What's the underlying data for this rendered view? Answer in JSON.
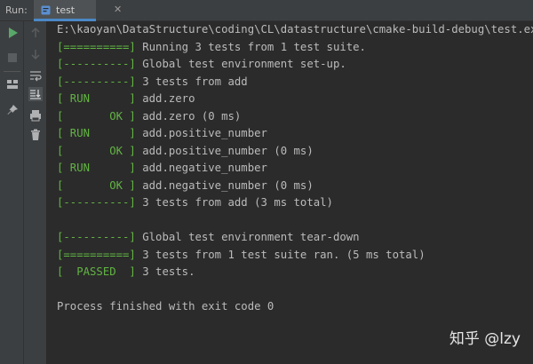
{
  "run_panel": {
    "label": "Run:",
    "tab": {
      "label": "test",
      "icon": "test-config-icon",
      "close_icon": "close-icon"
    }
  },
  "toolbar": {
    "left": [
      "run-icon",
      "stop-icon",
      "layout-icon",
      "pin-icon"
    ],
    "right": [
      "up-arrow-icon",
      "down-arrow-icon",
      "soft-wrap-icon",
      "scroll-to-end-icon",
      "print-icon",
      "delete-icon"
    ]
  },
  "console": {
    "lines": [
      {
        "prefix": "",
        "text": "E:\\kaoyan\\DataStructure\\coding\\CL\\datastructure\\cmake-build-debug\\test.exe"
      },
      {
        "prefix": "[==========]",
        "text": " Running 3 tests from 1 test suite."
      },
      {
        "prefix": "[----------]",
        "text": " Global test environment set-up."
      },
      {
        "prefix": "[----------]",
        "text": " 3 tests from add"
      },
      {
        "prefix": "[ RUN      ]",
        "text": " add.zero"
      },
      {
        "prefix": "[       OK ]",
        "text": " add.zero (0 ms)"
      },
      {
        "prefix": "[ RUN      ]",
        "text": " add.positive_number"
      },
      {
        "prefix": "[       OK ]",
        "text": " add.positive_number (0 ms)"
      },
      {
        "prefix": "[ RUN      ]",
        "text": " add.negative_number"
      },
      {
        "prefix": "[       OK ]",
        "text": " add.negative_number (0 ms)"
      },
      {
        "prefix": "[----------]",
        "text": " 3 tests from add (3 ms total)"
      },
      {
        "prefix": "",
        "text": ""
      },
      {
        "prefix": "[----------]",
        "text": " Global test environment tear-down"
      },
      {
        "prefix": "[==========]",
        "text": " 3 tests from 1 test suite ran. (5 ms total)"
      },
      {
        "prefix": "[  PASSED  ]",
        "text": " 3 tests."
      },
      {
        "prefix": "",
        "text": ""
      },
      {
        "prefix": "",
        "text": "Process finished with exit code 0"
      }
    ]
  },
  "watermark": "知乎 @lzy",
  "colors": {
    "background": "#2b2b2b",
    "panel": "#3c3f41",
    "test_prefix": "#62b543",
    "text": "#bbbbbb",
    "tab_underline": "#4a88c7"
  }
}
